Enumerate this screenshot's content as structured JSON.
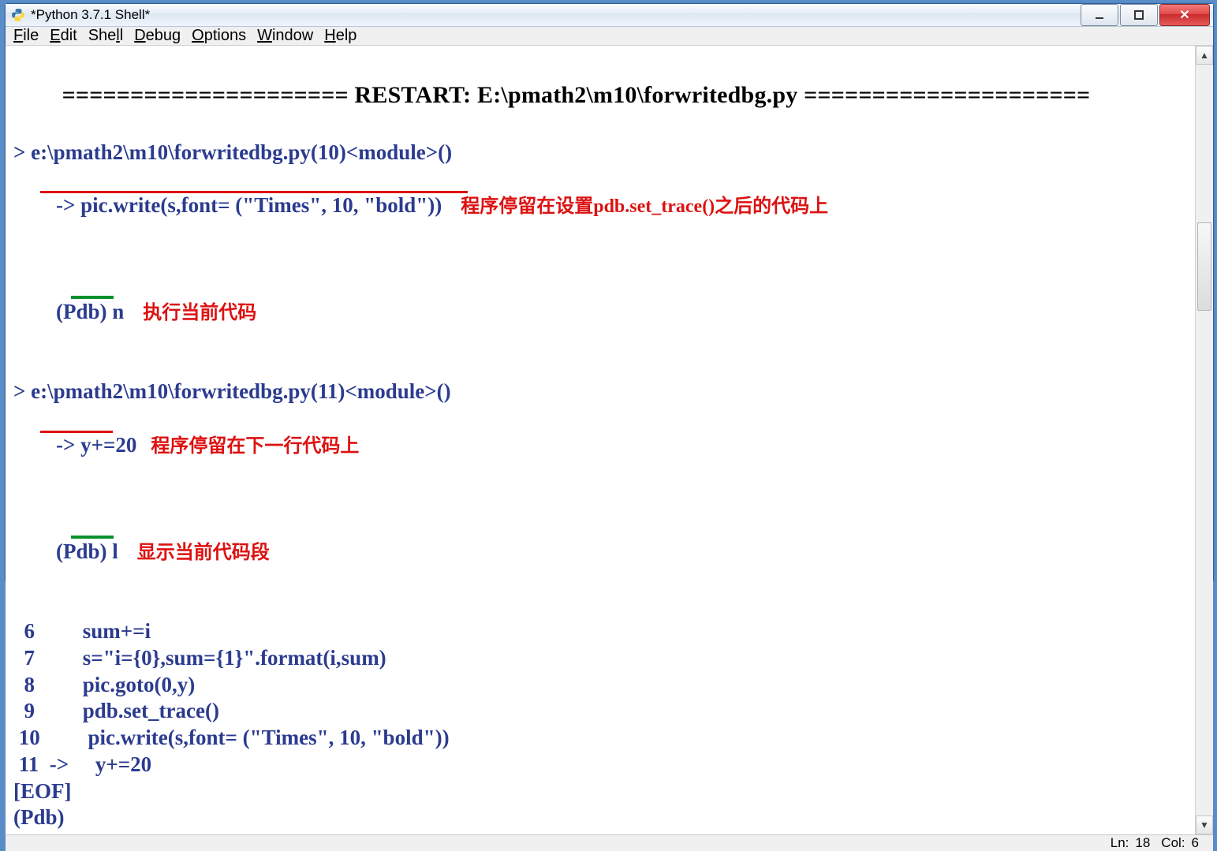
{
  "window": {
    "title": "*Python 3.7.1 Shell*"
  },
  "menu": {
    "file": {
      "accel": "F",
      "rest": "ile"
    },
    "edit": {
      "accel": "E",
      "rest": "dit"
    },
    "shell": {
      "accel": "",
      "label": "Shell",
      "rest_accel": "l"
    },
    "debug": {
      "accel": "D",
      "rest": "ebug"
    },
    "options": {
      "accel": "O",
      "rest": "ptions"
    },
    "windowm": {
      "accel": "W",
      "rest": "indow"
    },
    "help": {
      "accel": "H",
      "rest": "elp"
    }
  },
  "shell": {
    "restart_eq_left": "=====================",
    "restart_label": " RESTART: E:\\pmath2\\m10\\forwritedbg.py ",
    "restart_eq_right": "=====================",
    "line1": "> e:\\pmath2\\m10\\forwritedbg.py(10)<module>()",
    "line2_arrow": "-> ",
    "line2_code": "pic.write(s,font= (\"Times\", 10, \"bold\"))",
    "note1": "    程序停留在设置pdb.set_trace()之后的代码上",
    "pdb1": "(Pdb) ",
    "pdb1_cmd": "n",
    "note2": "    执行当前代码",
    "line3": "> e:\\pmath2\\m10\\forwritedbg.py(11)<module>()",
    "line4_arrow": "-> ",
    "line4_code": "y+=20",
    "note3": "   程序停留在下一行代码上",
    "pdb2": "(Pdb) ",
    "pdb2_cmd": "l",
    "note4": "    显示当前代码段",
    "listing": [
      {
        "num": "  6  ",
        "code": "       sum+=i"
      },
      {
        "num": "  7  ",
        "code": "       s=\"i={0},sum={1}\".format(i,sum)"
      },
      {
        "num": "  8  ",
        "code": "       pic.goto(0,y)"
      },
      {
        "num": "  9  ",
        "code": "       pdb.set_trace()"
      },
      {
        "num": " 10  ",
        "code": "       pic.write(s,font= (\"Times\", 10, \"bold\"))"
      },
      {
        "num": " 11  -> ",
        "code": "    y+=20"
      }
    ],
    "eof": "[EOF]",
    "pdb3": "(Pdb) "
  },
  "status": {
    "ln_label": "Ln:",
    "ln": "18",
    "col_label": "Col:",
    "col": "6"
  }
}
